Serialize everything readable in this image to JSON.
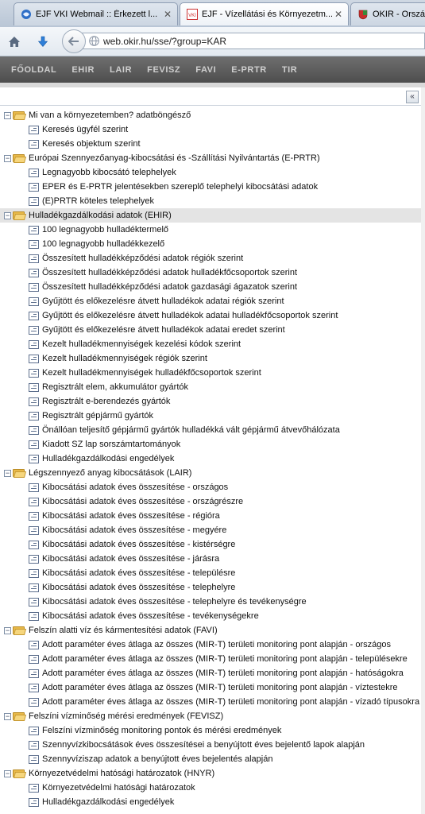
{
  "browser": {
    "tabs": [
      {
        "title": "EJF VKI Webmail :: Érkezett l...",
        "icon": "webmail-icon",
        "active": false
      },
      {
        "title": "EJF - Vízellátási és Környezetm...",
        "icon": "vki-logo-icon",
        "active": true
      },
      {
        "title": "OKIR - Ország",
        "icon": "coat-of-arms-icon",
        "active": false
      }
    ],
    "url": "web.okir.hu/sse/?group=KAR"
  },
  "site_menu": [
    "FŐOLDAL",
    "EHIR",
    "LAIR",
    "FEVISZ",
    "FAVI",
    "E-PRTR",
    "TIR"
  ],
  "panel": {
    "collapse_label": "«"
  },
  "tree": [
    {
      "label": "Mi van a környezetemben? adatböngésző",
      "items": [
        "Keresés ügyfél szerint",
        "Keresés objektum szerint"
      ]
    },
    {
      "label": "Európai Szennyezőanyag-kibocsátási és -Szállítási Nyilvántartás (E-PRTR)",
      "items": [
        "Legnagyobb kibocsátó telephelyek",
        "EPER és E-PRTR jelentésekben szereplő telephelyi kibocsátási adatok",
        "(E)PRTR köteles telephelyek"
      ]
    },
    {
      "label": "Hulladékgazdálkodási adatok (EHIR)",
      "highlight": true,
      "items": [
        "100 legnagyobb hulladéktermelő",
        "100 legnagyobb hulladékkezelő",
        "Összesített hulladékképződési adatok régiók szerint",
        "Összesített hulladékképződési adatok hulladékfőcsoportok szerint",
        "Összesített hulladékképződési adatok gazdasági ágazatok szerint",
        "Gyűjtött és előkezelésre átvett hulladékok adatai régiók szerint",
        "Gyűjtött és előkezelésre átvett hulladékok adatai hulladékfőcsoportok szerint",
        "Gyűjtött és előkezelésre átvett hulladékok adatai eredet szerint",
        "Kezelt hulladékmennyiségek kezelési kódok szerint",
        "Kezelt hulladékmennyiségek régiók szerint",
        "Kezelt hulladékmennyiségek hulladékfőcsoportok szerint",
        "Regisztrált elem, akkumulátor gyártók",
        "Regisztrált e-berendezés gyártók",
        "Regisztrált gépjármű gyártók",
        "Önállóan teljesítő gépjármű gyártók hulladékká vált gépjármű átvevőhálózata",
        "Kiadott SZ lap sorszámtartományok",
        "Hulladékgazdálkodási engedélyek"
      ]
    },
    {
      "label": "Légszennyező anyag kibocsátások (LAIR)",
      "items": [
        "Kibocsátási adatok éves összesítése - országos",
        "Kibocsátási adatok éves összesítése - országrészre",
        "Kibocsátási adatok éves összesítése - régióra",
        "Kibocsátási adatok éves összesítése - megyére",
        "Kibocsátási adatok éves összesítése - kistérségre",
        "Kibocsátási adatok éves összesítése - járásra",
        "Kibocsátási adatok éves összesítése - településre",
        "Kibocsátási adatok éves összesítése - telephelyre",
        "Kibocsátási adatok éves összesítése - telephelyre és tevékenységre",
        "Kibocsátási adatok éves összesítése - tevékenységekre"
      ]
    },
    {
      "label": "Felszín alatti víz és kármentesítési adatok (FAVI)",
      "items": [
        "Adott paraméter éves átlaga az összes (MIR-T) területi monitoring pont alapján - országos",
        "Adott paraméter éves átlaga az összes (MIR-T) területi monitoring pont alapján - településekre",
        "Adott paraméter éves átlaga az összes (MIR-T) területi monitoring pont alapján - hatóságokra",
        "Adott paraméter éves átlaga az összes (MIR-T) területi monitoring pont alapján - víztestekre",
        "Adott paraméter éves átlaga az összes (MIR-T) területi monitoring pont alapján - vízadó típusokra"
      ]
    },
    {
      "label": "Felszíni vízminőség mérési eredmények (FEVISZ)",
      "items": [
        "Felszíni vízminőség monitoring pontok és mérési eredmények",
        "Szennyvízkibocsátások éves összesítései a benyújtott éves bejelentő lapok alapján",
        "Szennyvíziszap adatok a benyújtott éves bejelentés alapján"
      ]
    },
    {
      "label": "Környezetvédelmi hatósági határozatok (HNYR)",
      "items": [
        "Környezetvédelmi hatósági határozatok",
        "Hulladékgazdálkodási engedélyek"
      ]
    }
  ]
}
